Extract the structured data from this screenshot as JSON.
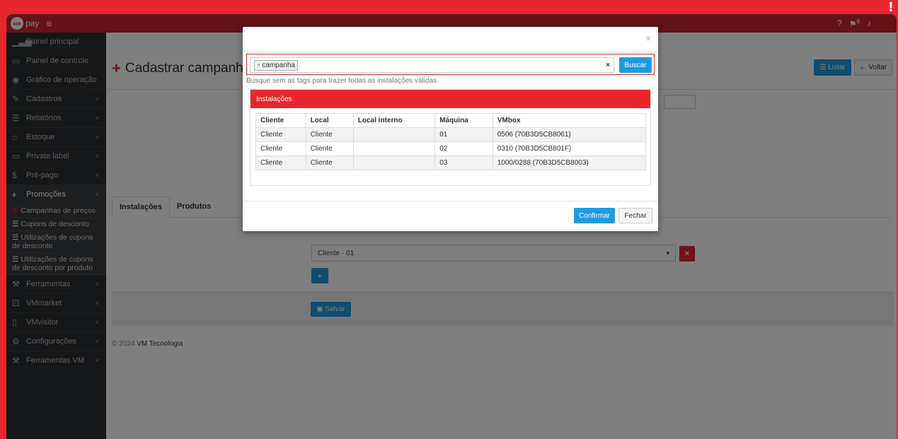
{
  "app": {
    "logo_text": "pay",
    "logo_mark": "vm"
  },
  "topbar": {
    "help_icon": "?",
    "notif_count": "9"
  },
  "sidebar": {
    "items": [
      {
        "label": "Painel principal",
        "icon": "chart-icon",
        "glyph": "▁▃▅"
      },
      {
        "label": "Painel de controle",
        "icon": "monitor-icon",
        "glyph": "▭"
      },
      {
        "label": "Gráfico de operação",
        "icon": "car-icon",
        "glyph": "◉"
      },
      {
        "label": "Cadastros",
        "icon": "edit-icon",
        "glyph": "✎",
        "chev": "˅"
      },
      {
        "label": "Relatórios",
        "icon": "file-icon",
        "glyph": "☰",
        "chev": "˅"
      },
      {
        "label": "Estoque",
        "icon": "home-icon",
        "glyph": "⌂",
        "chev": "˅"
      },
      {
        "label": "Private label",
        "icon": "card-icon",
        "glyph": "▭",
        "chev": "˅"
      },
      {
        "label": "Pré-pago",
        "icon": "dollar-icon",
        "glyph": "$",
        "chev": "˅"
      },
      {
        "label": "Promoções",
        "icon": "gift-icon",
        "glyph": "♦",
        "chev": "˅"
      }
    ],
    "subitems": [
      {
        "label": "Campanhas de preços"
      },
      {
        "label": "Cupons de desconto"
      },
      {
        "label": "Utilizações de cupons de desconto"
      },
      {
        "label": "Utilizações de cupons de desconto por produto"
      }
    ],
    "items_after": [
      {
        "label": "Ferramentas",
        "icon": "wrench-icon",
        "glyph": "⚒",
        "chev": "˅"
      },
      {
        "label": "VMmarket",
        "icon": "cart-icon",
        "glyph": "⚀",
        "chev": "˅"
      },
      {
        "label": "VMvisitor",
        "icon": "phone-icon",
        "glyph": "▯",
        "chev": "˅"
      },
      {
        "label": "Configurações",
        "icon": "gears-icon",
        "glyph": "⚙",
        "chev": "˅"
      },
      {
        "label": "Ferramentas VM",
        "icon": "wrench-icon",
        "glyph": "⚒",
        "chev": "˅"
      }
    ]
  },
  "main": {
    "title": "Cadastrar campanha",
    "list_label": "Listar",
    "back_label": "Voltar",
    "tabs": [
      "Instalações",
      "Produtos"
    ],
    "select_value": "Cliente - 01",
    "save_label": "Salvar",
    "footer_year": "© 2024",
    "footer_brand": "VM Tecnologia"
  },
  "modal": {
    "tag": "campanha",
    "clear": "×",
    "search_label": "Buscar",
    "hint": "Busque sem as tags para trazer todas as instalações válidas.",
    "panel_title": "Instalações",
    "columns": [
      "Cliente",
      "Local",
      "Local interno",
      "Máquina",
      "VMbox"
    ],
    "rows": [
      [
        "Cliente",
        "Cliente",
        "",
        "01",
        "0506 (70B3D5CB8061)"
      ],
      [
        "Cliente",
        "Cliente",
        "",
        "02",
        "0310 (70B3D5CB801F)"
      ],
      [
        "Cliente",
        "Cliente",
        "",
        "03",
        "1000/0288 (70B3D5CB8003)"
      ]
    ],
    "confirm_label": "Confirmar",
    "close_label": "Fechar"
  }
}
